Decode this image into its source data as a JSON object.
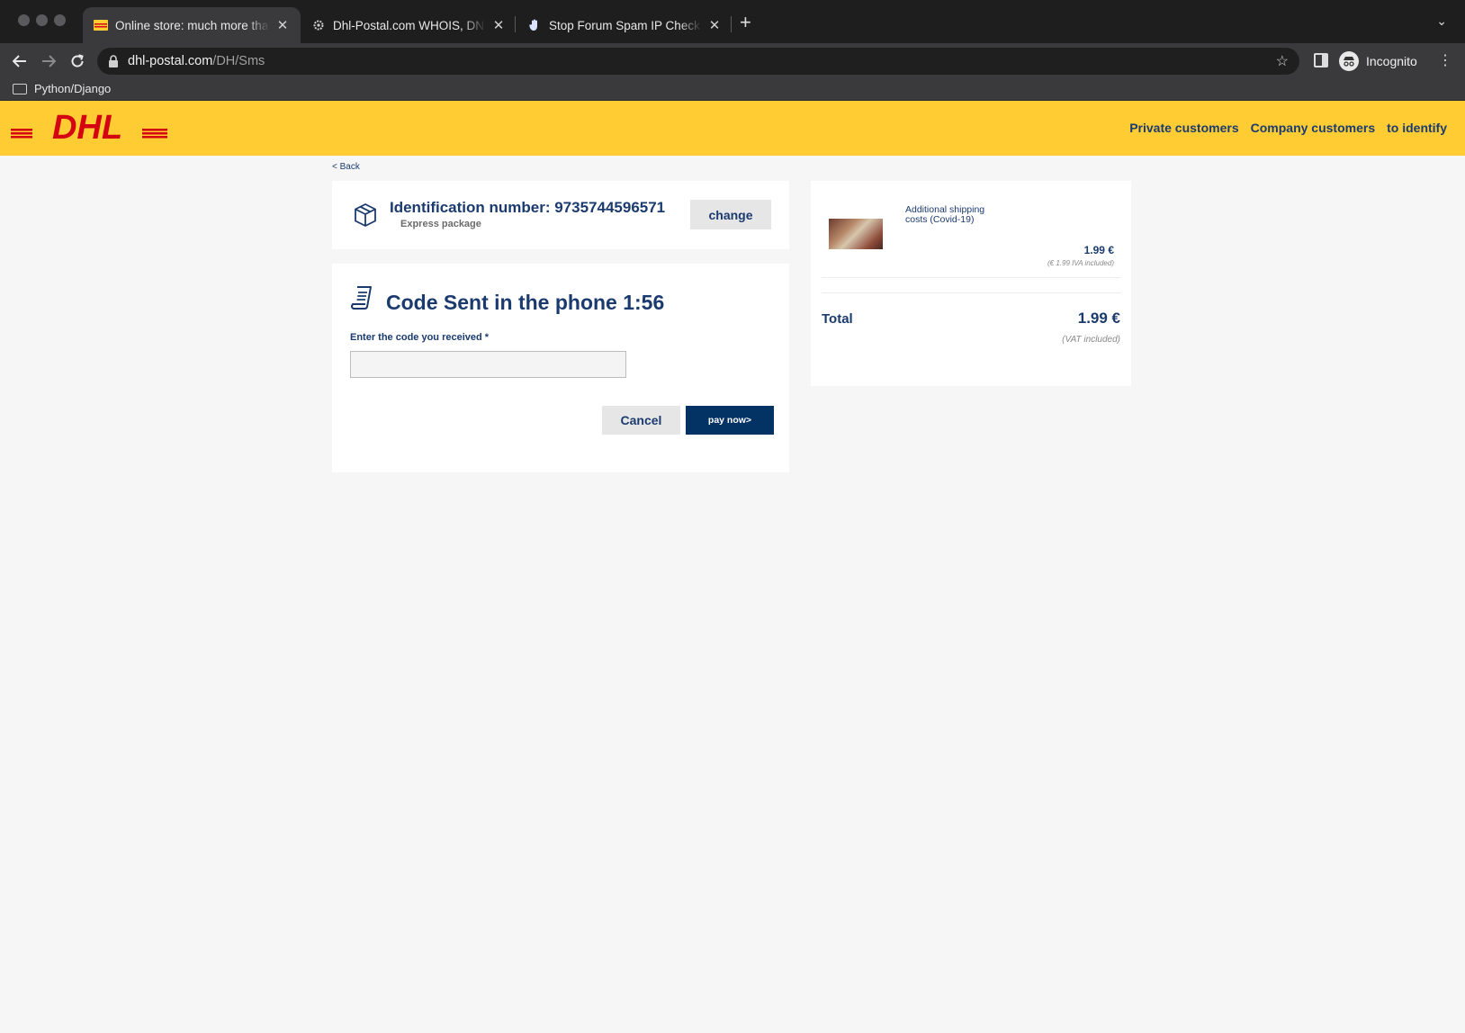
{
  "browser": {
    "tabs": [
      {
        "title": "Online store: much more than I",
        "active": true
      },
      {
        "title": "Dhl-Postal.com WHOIS, DNS, &",
        "active": false
      },
      {
        "title": "Stop Forum Spam IP Check - 3",
        "active": false
      }
    ],
    "url_host": "dhl-postal.com",
    "url_path": "/DH/Sms",
    "profile_label": "Incognito",
    "bookmarks": [
      {
        "label": "Python/Django"
      }
    ]
  },
  "header": {
    "logo_text": "DHL",
    "brand_color": "#ffcc33",
    "logo_color": "#d40511",
    "nav": [
      "Private customers",
      "Company customers",
      "to identify"
    ]
  },
  "page": {
    "back_link": "< Back",
    "id_card": {
      "title": "Identification number: 9735744596571",
      "subtitle": "Express package",
      "change_label": "change"
    },
    "code_card": {
      "title": "Code Sent in the phone 1:56",
      "field_label": "Enter the code you received *",
      "field_value": "",
      "cancel_label": "Cancel",
      "pay_label": "pay now>"
    },
    "summary": {
      "item_name": "Additional shipping costs (Covid-19)",
      "item_price": "1.99 €",
      "item_tax_note": "(€ 1.99 IVA included)",
      "total_label": "Total",
      "total_value": "1.99 €",
      "total_note": "(VAT included)"
    }
  },
  "colors": {
    "navy": "#1b3b6f",
    "button_dark": "#033264"
  }
}
